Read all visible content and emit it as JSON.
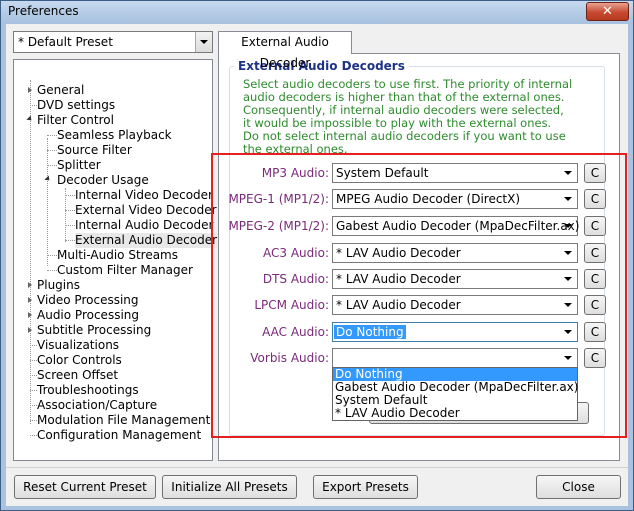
{
  "window": {
    "title": "Preferences",
    "close_glyph": "✕"
  },
  "preset": {
    "selected": "* Default Preset"
  },
  "tree": {
    "items": [
      "General",
      "DVD settings",
      "Filter Control",
      "Seamless Playback",
      "Source Filter",
      "Splitter",
      "Decoder Usage",
      "Internal Video Decoder",
      "External Video Decoder",
      "Internal Audio Decoder",
      "External Audio Decoder",
      "Multi-Audio Streams",
      "Custom Filter Manager",
      "Plugins",
      "Video Processing",
      "Audio Processing",
      "Subtitle Processing",
      "Visualizations",
      "Color Controls",
      "Screen Offset",
      "Troubleshootings",
      "Association/Capture",
      "Modulation File Management",
      "Configuration Management"
    ],
    "selected": "External Audio Decoder"
  },
  "tab": {
    "label": "External Audio Decoder"
  },
  "group": {
    "title": "External Audio Decoders",
    "description": [
      "Select audio decoders to use first. The priority of internal",
      "audio decoders is higher than that of the external ones.",
      "Consequently, if internal audio decoders were selected,",
      "it would be impossible to play with the external ones.",
      "Do not select internal audio decoders if you want to use",
      "the external ones."
    ]
  },
  "decoders": [
    {
      "label": "MP3 Audio:",
      "value": "System Default",
      "button": "C"
    },
    {
      "label": "MPEG-1 (MP1/2):",
      "value": "MPEG Audio Decoder (DirectX)",
      "button": "C"
    },
    {
      "label": "MPEG-2 (MP1/2):",
      "value": "Gabest Audio Decoder (MpaDecFilter.ax)",
      "button": "C"
    },
    {
      "label": "AC3 Audio:",
      "value": "* LAV Audio Decoder",
      "button": "C"
    },
    {
      "label": "DTS Audio:",
      "value": "* LAV Audio Decoder",
      "button": "C"
    },
    {
      "label": "LPCM Audio:",
      "value": "* LAV Audio Decoder",
      "button": "C"
    },
    {
      "label": "AAC Audio:",
      "value": "Do Nothing",
      "button": "C"
    },
    {
      "label": "Vorbis Audio:",
      "value": "",
      "button": "C"
    }
  ],
  "aac_dropdown": {
    "options": [
      "Do Nothing",
      "Gabest Audio Decoder (MpaDecFilter.ax)",
      "System Default",
      "* LAV Audio Decoder"
    ],
    "highlighted": "Do Nothing"
  },
  "buttons": {
    "reset": "Reset Current Preset",
    "initialize": "Initialize All Presets",
    "export": "Export Presets",
    "close": "Close"
  },
  "colors": {
    "description_text": "#2e8b2e",
    "row_label_text": "#7a2a7a",
    "group_title_text": "#1e3287",
    "highlight_rect": "#e62020",
    "selection_blue": "#3399ff"
  }
}
